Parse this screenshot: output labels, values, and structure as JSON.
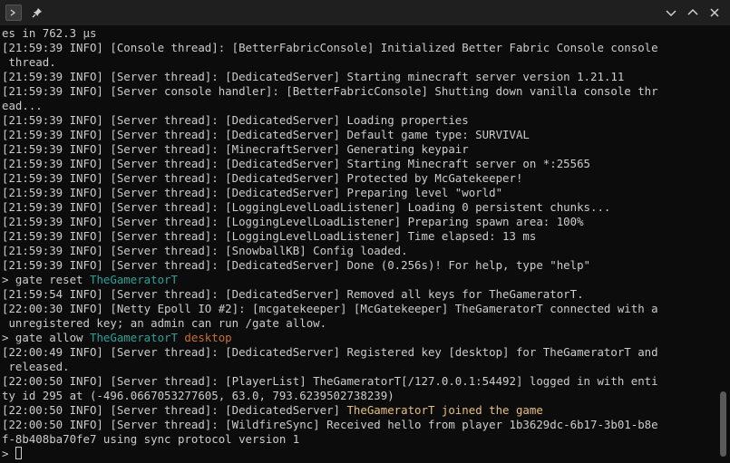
{
  "titlebar": {
    "icons": [
      "terminal-icon",
      "pin-icon",
      "chevron-down-icon",
      "chevron-up-icon",
      "close-icon"
    ],
    "glyphs": {
      "terminal": ">",
      "pin": "📌",
      "down": "∨",
      "up": "∧",
      "close": "✕"
    }
  },
  "colors": {
    "background": "#0c0c0c",
    "text": "#cccccc",
    "player_name": "#2aa198",
    "key_name": "#c7702d",
    "join_message": "#e5c07b"
  },
  "log": [
    {
      "text": "es in 762.3 µs"
    },
    {
      "text": "[21:59:39 INFO] [Console thread]: [BetterFabricConsole] Initialized Better Fabric Console console"
    },
    {
      "text": " thread."
    },
    {
      "text": "[21:59:39 INFO] [Server thread]: [DedicatedServer] Starting minecraft server version 1.21.11"
    },
    {
      "text": "[21:59:39 INFO] [Server console handler]: [BetterFabricConsole] Shutting down vanilla console thr"
    },
    {
      "text": "ead..."
    },
    {
      "text": "[21:59:39 INFO] [Server thread]: [DedicatedServer] Loading properties"
    },
    {
      "text": "[21:59:39 INFO] [Server thread]: [DedicatedServer] Default game type: SURVIVAL"
    },
    {
      "text": "[21:59:39 INFO] [Server thread]: [MinecraftServer] Generating keypair"
    },
    {
      "text": "[21:59:39 INFO] [Server thread]: [DedicatedServer] Starting Minecraft server on *:25565"
    },
    {
      "text": "[21:59:39 INFO] [Server thread]: [DedicatedServer] Protected by McGatekeeper!"
    },
    {
      "text": "[21:59:39 INFO] [Server thread]: [DedicatedServer] Preparing level \"world\""
    },
    {
      "text": "[21:59:39 INFO] [Server thread]: [LoggingLevelLoadListener] Loading 0 persistent chunks..."
    },
    {
      "text": "[21:59:39 INFO] [Server thread]: [LoggingLevelLoadListener] Preparing spawn area: 100%"
    },
    {
      "text": "[21:59:39 INFO] [Server thread]: [LoggingLevelLoadListener] Time elapsed: 13 ms"
    },
    {
      "text": "[21:59:39 INFO] [Server thread]: [SnowballKB] Config loaded."
    },
    {
      "text": "[21:59:39 INFO] [Server thread]: [DedicatedServer] Done (0.256s)! For help, type \"help\""
    },
    {
      "cmd": "> gate reset ",
      "arg1": "TheGameratorT"
    },
    {
      "text": "[21:59:54 INFO] [Server thread]: [DedicatedServer] Removed all keys for TheGameratorT."
    },
    {
      "text": "[22:00:30 INFO] [Netty Epoll IO #2]: [mcgatekeeper] [McGatekeeper] TheGameratorT connected with a"
    },
    {
      "text": " unregistered key; an admin can run /gate allow."
    },
    {
      "cmd": "> gate allow ",
      "arg1": "TheGameratorT",
      "arg2": " desktop"
    },
    {
      "text": "[22:00:49 INFO] [Server thread]: [DedicatedServer] Registered key [desktop] for TheGameratorT and"
    },
    {
      "text": " released."
    },
    {
      "text": "[22:00:50 INFO] [Server thread]: [PlayerList] TheGameratorT[/127.0.0.1:54492] logged in with enti"
    },
    {
      "text": "ty id 295 at (-496.0667053277605, 63.0, 793.6239502738239)"
    },
    {
      "prefix": "[22:00:50 INFO] [Server thread]: [DedicatedServer] ",
      "highlight": "TheGameratorT joined the game"
    },
    {
      "text": "[22:00:50 INFO] [Server thread]: [WildfireSync] Received hello from player 1b3629dc-6b17-3b01-b8e"
    },
    {
      "text": "f-8b408ba70fe7 using sync protocol version 1"
    }
  ],
  "prompt": "> "
}
